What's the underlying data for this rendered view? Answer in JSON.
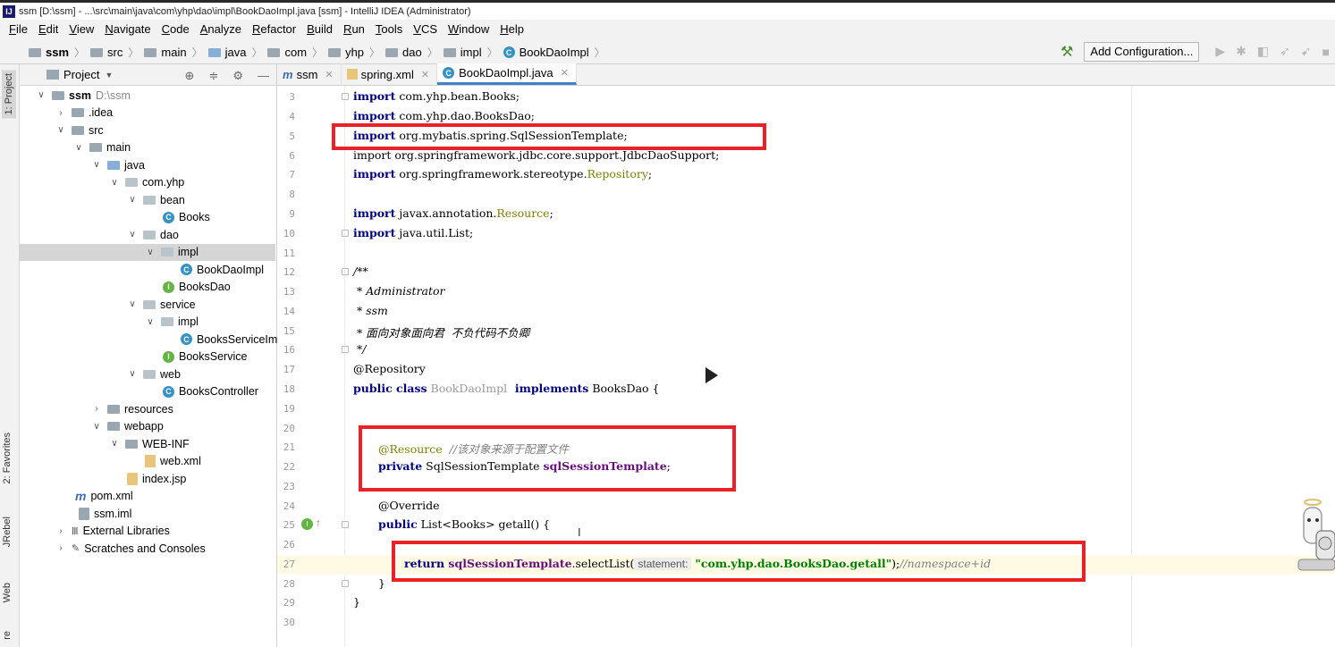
{
  "window": {
    "app_icon": "intellij-logo",
    "title": "ssm [D:\\ssm] - ...\\src\\main\\java\\com\\yhp\\dao\\impl\\BookDaoImpl.java [ssm] - IntelliJ IDEA (Administrator)"
  },
  "menu": [
    "File",
    "Edit",
    "View",
    "Navigate",
    "Code",
    "Analyze",
    "Refactor",
    "Build",
    "Run",
    "Tools",
    "VCS",
    "Window",
    "Help"
  ],
  "breadcrumb": [
    "ssm",
    "src",
    "main",
    "java",
    "com",
    "yhp",
    "dao",
    "impl",
    "BookDaoImpl"
  ],
  "toolbar": {
    "add_configuration": "Add Configuration..."
  },
  "left_strip": {
    "project": "1: Project",
    "favorites": "2: Favorites",
    "jrebel": "JRebel",
    "web": "Web",
    "structure": "re"
  },
  "project_panel": {
    "title": "Project",
    "tree": [
      {
        "label": "ssm",
        "extra": "D:\\ssm"
      },
      {
        "label": ".idea"
      },
      {
        "label": "src"
      },
      {
        "label": "main"
      },
      {
        "label": "java"
      },
      {
        "label": "com.yhp"
      },
      {
        "label": "bean"
      },
      {
        "label": "Books"
      },
      {
        "label": "dao"
      },
      {
        "label": "impl"
      },
      {
        "label": "BookDaoImpl"
      },
      {
        "label": "BooksDao"
      },
      {
        "label": "service"
      },
      {
        "label": "impl"
      },
      {
        "label": "BooksServiceIm"
      },
      {
        "label": "BooksService"
      },
      {
        "label": "web"
      },
      {
        "label": "BooksController"
      },
      {
        "label": "resources"
      },
      {
        "label": "webapp"
      },
      {
        "label": "WEB-INF"
      },
      {
        "label": "web.xml"
      },
      {
        "label": "index.jsp"
      },
      {
        "label": "pom.xml"
      },
      {
        "label": "ssm.iml"
      },
      {
        "label": "External Libraries"
      },
      {
        "label": "Scratches and Consoles"
      }
    ]
  },
  "tabs": [
    {
      "label": "ssm"
    },
    {
      "label": "spring.xml"
    },
    {
      "label": "BookDaoImpl.java"
    }
  ],
  "code": {
    "line_numbers": [
      "3",
      "4",
      "5",
      "6",
      "7",
      "8",
      "9",
      "10",
      "11",
      "12",
      "13",
      "14",
      "15",
      "16",
      "17",
      "18",
      "19",
      "20",
      "21",
      "22",
      "23",
      "24",
      "25",
      "26",
      "27",
      "28",
      "29",
      "30"
    ],
    "l3": {
      "kw": "import",
      "rest": " com.yhp.bean.Books;"
    },
    "l4": {
      "kw": "import",
      "rest": " com.yhp.dao.BooksDao;"
    },
    "l5": {
      "kw": "import",
      "rest": " org.mybatis.spring.SqlSessionTemplate;"
    },
    "l6": {
      "kw": "import",
      "rest": " org.springframework.jdbc.core.support.JdbcDaoSupport;"
    },
    "l7": {
      "kw": "import",
      "rest_a": " org.springframework.stereotype.",
      "rest_b": "Repository",
      "rest_c": ";"
    },
    "l9": {
      "kw": "import",
      "rest_a": " javax.annotation.",
      "rest_b": "Resource",
      "rest_c": ";"
    },
    "l10": {
      "kw": "import",
      "rest": " java.util.List;"
    },
    "l12": "/**",
    "l13": " * Administrator",
    "l14": " * ssm",
    "l15": " * 面向对象面向君  不负代码不负卿",
    "l16": " */",
    "l17": "@Repository",
    "l18": {
      "kw1": "public class",
      "name": " BookDaoImpl",
      "kw2": "  implements",
      "rest": " BooksDao {"
    },
    "l21": {
      "ann": "@Resource",
      "cmt": "  //该对象来源于配置文件"
    },
    "l22": {
      "kw": "private",
      "type": " SqlSessionTemplate ",
      "field": "sqlSessionTemplate",
      "end": ";"
    },
    "l24": "@Override",
    "l25": {
      "kw": "public",
      "rest": " List<Books> getall() {"
    },
    "l27": {
      "kw": "return",
      "field": " sqlSessionTemplate",
      "call": ".selectList(",
      "hint": "statement:",
      "str": "\"com.yhp.dao.BooksDao.getall\"",
      "close": ");",
      "cmt": "//namespace+id"
    },
    "l28": "}",
    "l29": "}"
  },
  "highlight_color": "#ec2027"
}
